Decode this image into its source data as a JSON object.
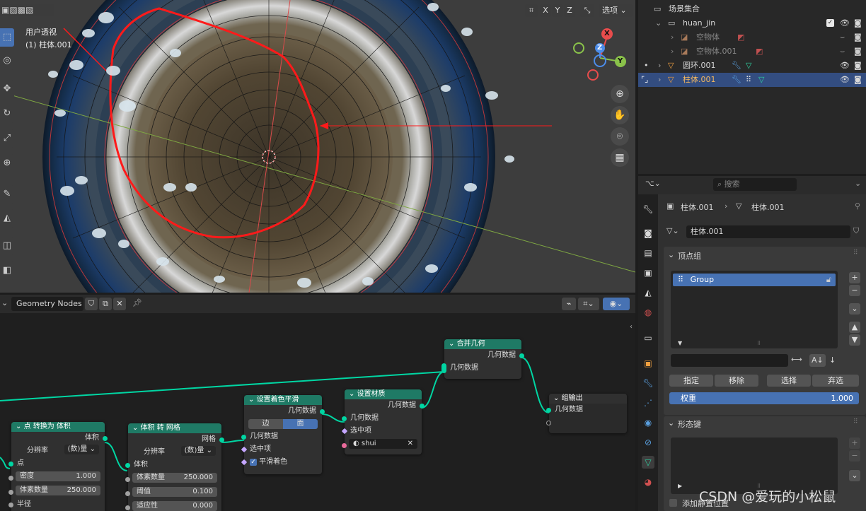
{
  "viewport": {
    "view_name": "用户透视",
    "object_label": "(1) 柱体.001",
    "axis_buttons": [
      "X",
      "Y",
      "Z"
    ],
    "options_label": "选项",
    "gizmo": {
      "x": "X",
      "y": "Y",
      "z": "Z"
    }
  },
  "node_editor": {
    "editor_name": "Geometry Nodes",
    "nodes": {
      "points_to_volume": {
        "title": "点 转换为 体积",
        "out_volume": "体积",
        "resolution_label": "分辨率",
        "resolution_value": "(数)量",
        "in_points": "点",
        "density_label": "密度",
        "density_value": "1.000",
        "voxel_count_label": "体素数量",
        "voxel_count_value": "250.000",
        "radius_label": "半径"
      },
      "volume_to_mesh": {
        "title": "体积 转 网格",
        "out_mesh": "网格",
        "resolution_label": "分辨率",
        "resolution_value": "(数)量",
        "in_volume": "体积",
        "voxel_count_label": "体素数量",
        "voxel_count_value": "250.000",
        "threshold_label": "阈值",
        "threshold_value": "0.100",
        "adaptivity_label": "适应性",
        "adaptivity_value": "0.000"
      },
      "set_shade_smooth": {
        "title": "设置着色平滑",
        "out_geometry": "几何数据",
        "tab_edge": "边",
        "tab_face": "面",
        "in_geometry": "几何数据",
        "in_selection": "选中项",
        "smooth_label": "平滑着色"
      },
      "set_material": {
        "title": "设置材质",
        "out_geometry": "几何数据",
        "in_geometry": "几何数据",
        "in_selection": "选中项",
        "material": "shui"
      },
      "join_geometry": {
        "title": "合并几何",
        "out_geometry": "几何数据",
        "in_geometry": "几何数据"
      },
      "group_output": {
        "title": "组输出",
        "in_geometry": "几何数据"
      }
    }
  },
  "outliner": {
    "rows": [
      {
        "label": "场景集合"
      },
      {
        "label": "huan_jin"
      },
      {
        "label": "空物体"
      },
      {
        "label": "空物体.001"
      },
      {
        "label": "圆环.001"
      },
      {
        "label": "柱体.001"
      }
    ]
  },
  "properties": {
    "search_placeholder": "搜索",
    "breadcrumb_object": "柱体.001",
    "breadcrumb_data": "柱体.001",
    "mesh_name": "柱体.001",
    "vertex_groups_title": "顶点组",
    "vertex_group_item": "Group",
    "btn_assign": "指定",
    "btn_remove": "移除",
    "btn_select": "选择",
    "btn_deselect": "弃选",
    "weight_label": "权重",
    "weight_value": "1.000",
    "shape_keys_title": "形态键",
    "add_rest_position": "添加静置位置"
  },
  "watermark": "CSDN @爱玩的小松鼠",
  "colors": {
    "accent": "#4772b3",
    "node_geometry": "#00d6a3",
    "node_header": "#1f7a65",
    "selection": "#334d80",
    "annotation": "#ff1a1a"
  }
}
